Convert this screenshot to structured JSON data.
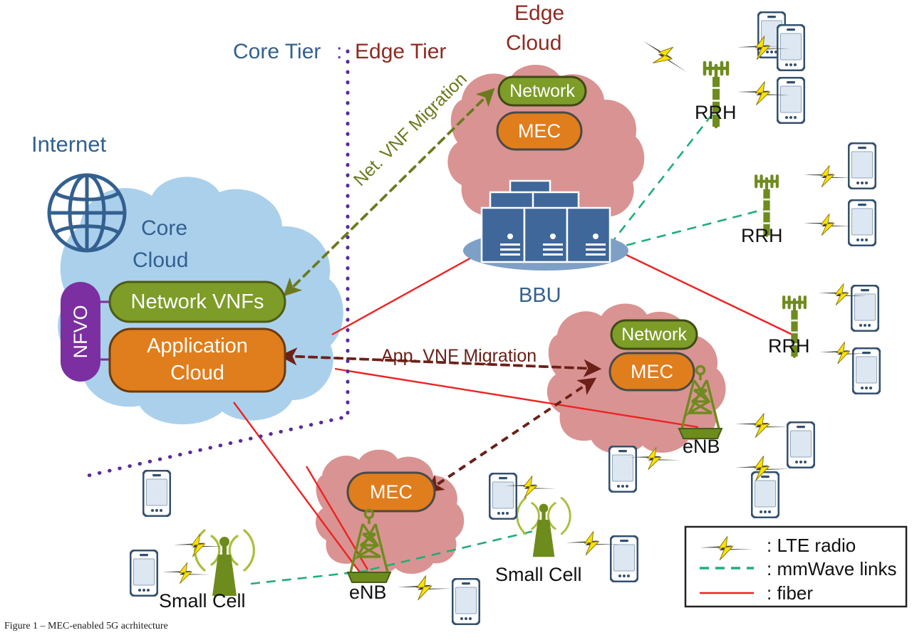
{
  "figure": {
    "caption": "Figure 1 – MEC-enabled 5G acrhitecture",
    "colors": {
      "core_tier_blue": "#33608f",
      "edge_tier_red": "#8c2b22",
      "core_cloud_fill": "#aad0ec",
      "edge_cloud_fill": "#d99392",
      "network_vnf_green": "#7d9c28",
      "app_cloud_orange": "#e07d1c",
      "nfvo_purple": "#7b2fa0",
      "bbu_blue": "#3f6799",
      "tower_olive": "#6e8b1e",
      "fiber_red": "#ee2222",
      "mmwave_green": "#1fae78",
      "lte_yellow": "#ffe200",
      "divider_purple": "#5b2a9b",
      "net_migration_olive": "#6b7a1e",
      "app_migration_maroon": "#6b2018"
    }
  },
  "tiers": {
    "core_label": "Core Tier",
    "separator": ":",
    "edge_label": "Edge Tier"
  },
  "internet": {
    "label": "Internet",
    "icon": "globe-icon"
  },
  "core_cloud": {
    "title_line1": "Core",
    "title_line2": "Cloud",
    "nfvo": "NFVO",
    "network_vnfs": "Network VNFs",
    "application_cloud_line1": "Application",
    "application_cloud_line2": "Cloud"
  },
  "edge_cloud_top": {
    "title_line1": "Edge",
    "title_line2": "Cloud",
    "network": "Network",
    "mec": "MEC"
  },
  "edge_cloud_mid": {
    "network": "Network",
    "mec": "MEC"
  },
  "edge_cloud_bottom": {
    "mec": "MEC"
  },
  "bbu": {
    "label": "BBU"
  },
  "migrations": {
    "net_vnf": "Net. VNF Migration",
    "app_vnf": "App. VNF Migration"
  },
  "radio_nodes": [
    {
      "id": "rrh-1",
      "type": "rrh",
      "label": "RRH"
    },
    {
      "id": "rrh-2",
      "type": "rrh",
      "label": "RRH"
    },
    {
      "id": "rrh-3",
      "type": "rrh",
      "label": "RRH"
    },
    {
      "id": "enb-1",
      "type": "enb",
      "label": "eNB"
    },
    {
      "id": "enb-2",
      "type": "enb",
      "label": "eNB"
    },
    {
      "id": "small-cell-1",
      "type": "small-cell",
      "label": "Small Cell"
    },
    {
      "id": "small-cell-2",
      "type": "small-cell",
      "label": "Small Cell"
    }
  ],
  "legend": {
    "items": [
      {
        "icon": "lightning-bolt-icon",
        "text": ": LTE radio"
      },
      {
        "icon": "dashed-green-line-icon",
        "text": ": mmWave links"
      },
      {
        "icon": "solid-red-line-icon",
        "text": ": fiber"
      }
    ]
  }
}
